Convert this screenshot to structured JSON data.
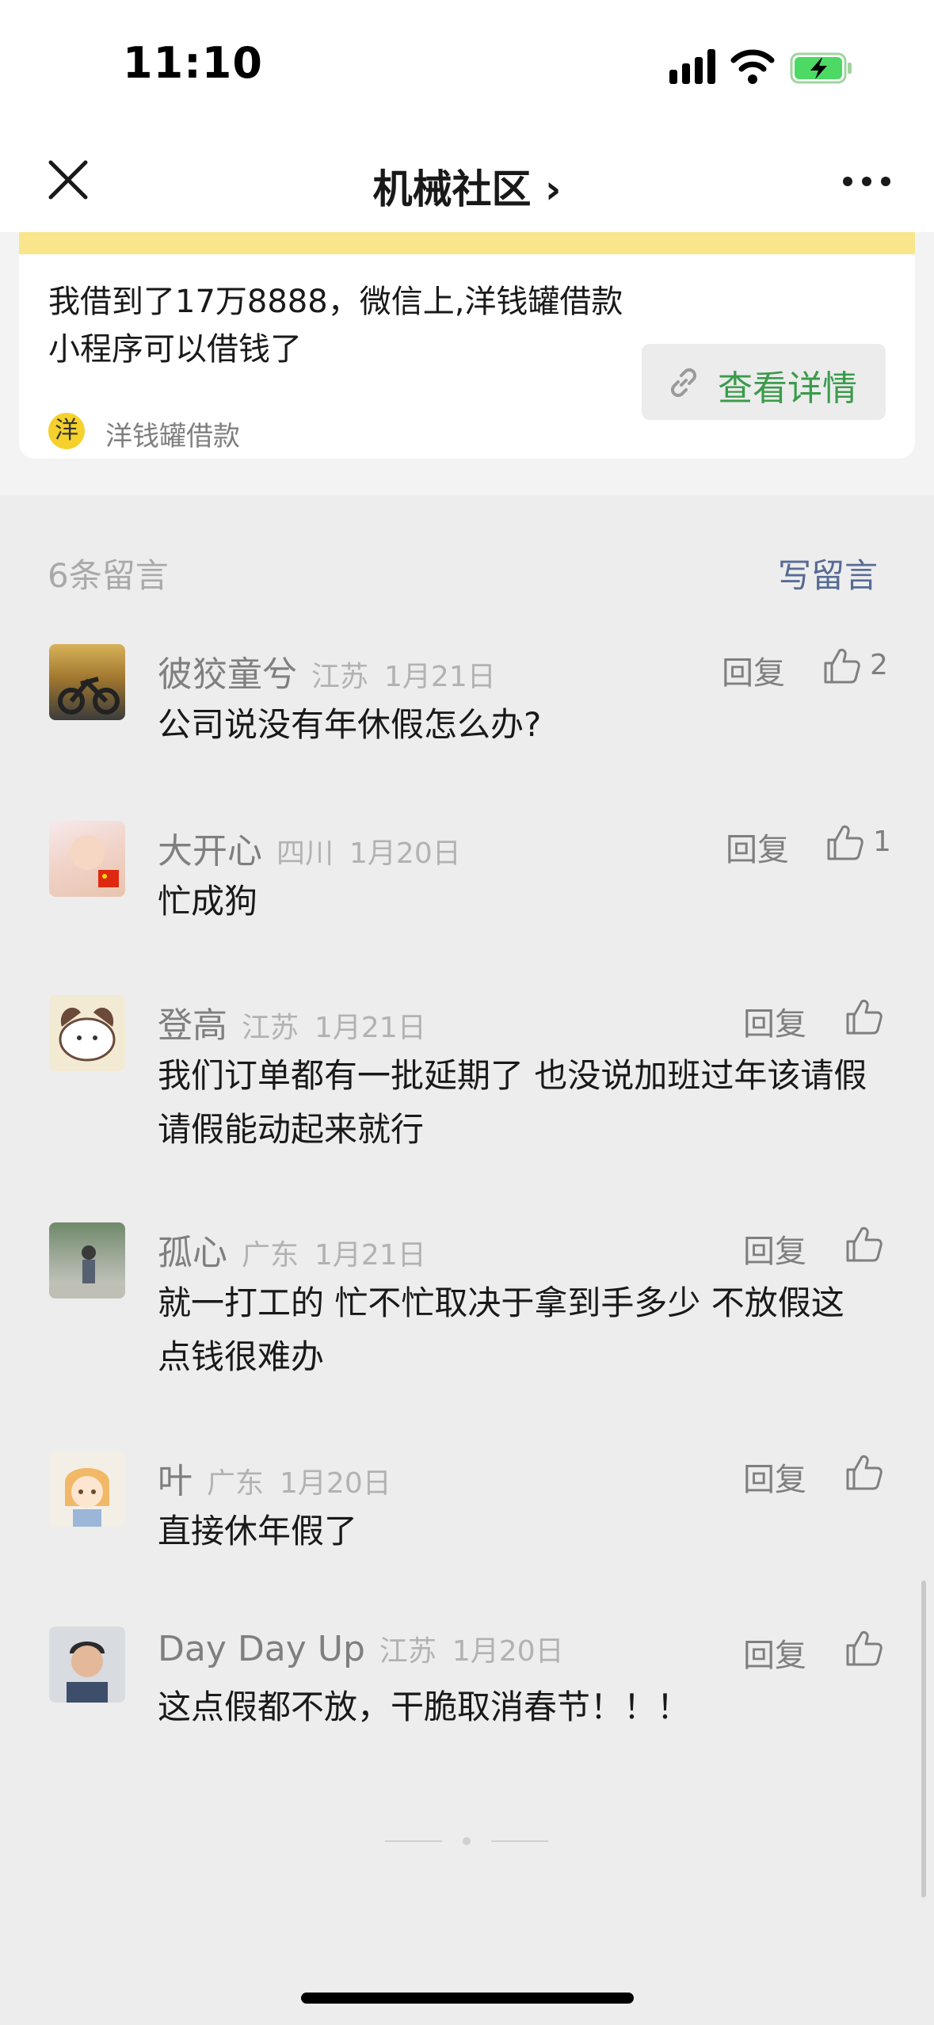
{
  "status_bar": {
    "time": "11:10"
  },
  "nav": {
    "title": "机械社区 ›"
  },
  "article": {
    "ad_text": "我借到了17万8888，微信上,洋钱罐借款小程序可以借钱了",
    "source_icon_char": "洋",
    "source_name": "洋钱罐借款",
    "detail_button": "查看详情"
  },
  "comments_header": {
    "count_label": "6条留言",
    "write_label": "写留言"
  },
  "reply_label": "回复",
  "comments": [
    {
      "name": "彼狡童兮",
      "location": "江苏",
      "date": "1月21日",
      "text": "公司说没有年休假怎么办?",
      "likes": "2"
    },
    {
      "name": "大开心",
      "location": "四川",
      "date": "1月20日",
      "text": "忙成狗",
      "likes": "1"
    },
    {
      "name": "登高",
      "location": "江苏",
      "date": "1月21日",
      "text": "我们订单都有一批延期了 也没说加班过年该请假请假能动起来就行",
      "likes": ""
    },
    {
      "name": "孤心",
      "location": "广东",
      "date": "1月21日",
      "text": "就一打工的  忙不忙取决于拿到手多少   不放假这点钱很难办",
      "likes": ""
    },
    {
      "name": "叶",
      "location": "广东",
      "date": "1月20日",
      "text": "直接休年假了",
      "likes": ""
    },
    {
      "name": "Day Day Up",
      "location": "江苏",
      "date": "1月20日",
      "text": "这点假都不放，干脆取消春节！！！",
      "likes": ""
    }
  ],
  "colors": {
    "accent_green": "#3b9b4c",
    "link_blue": "#576b95",
    "banner_yellow": "#f8e58c"
  }
}
